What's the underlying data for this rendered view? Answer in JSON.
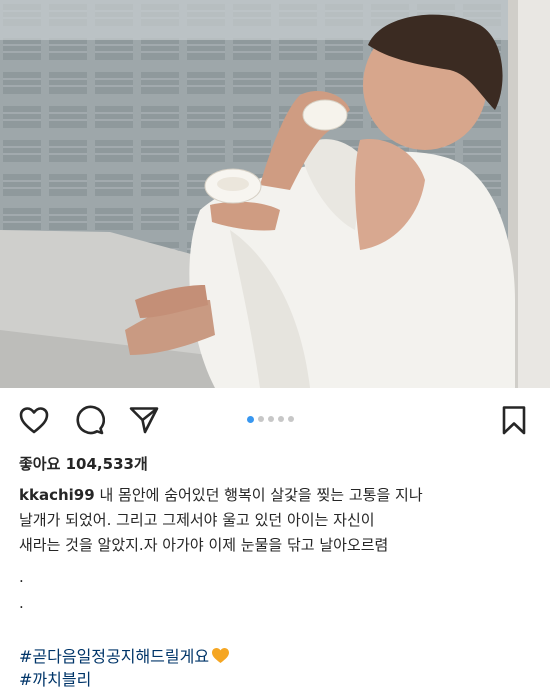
{
  "post": {
    "photo_alt": "",
    "likes_text": "좋아요 104,533개",
    "username": "kkachi99",
    "caption_text": "내 몸안에 숨어있던 행복이 살갗을 찢는 고통을 지나\n날개가 되었어. 그리고 그제서야 울고 있던 아이는 자신이\n새라는 것을 알았지.자 아가야 이제 눈물을 닦고 날아오르렴",
    "caption_dot_1": ".",
    "caption_dot_2": ".",
    "hashtags": [
      "#곧다음일정공지해드릴게요",
      "#까치블리"
    ]
  },
  "carousel": {
    "count": 5,
    "active_index": 0
  },
  "icons": {
    "like": "heart-outline-icon",
    "comment": "comment-bubble-icon",
    "share": "paper-plane-icon",
    "save": "bookmark-icon",
    "emoji": "orange-heart-emoji"
  },
  "colors": {
    "accent_dot": "#3897f0",
    "hashtag": "#003569",
    "emoji_heart": "#f5a623"
  }
}
